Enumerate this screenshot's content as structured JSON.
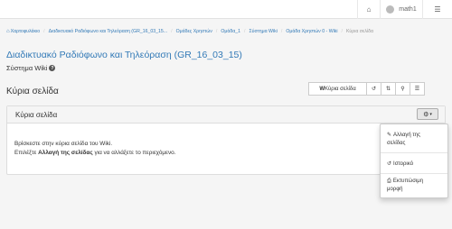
{
  "topbar": {
    "home_icon": "home-icon",
    "user_name": "math1",
    "menu_icon": "sliders-icon"
  },
  "breadcrumb": [
    "Χαρτοφυλάκιο",
    "Διαδικτυακό Ραδιόφωνο και Τηλεόραση (GR_16_03_15...",
    "Ομάδες Χρηστών",
    "Ομάδα_1",
    "Σύστημα Wiki",
    "Ομάδα Χρηστών 0 - Wiki",
    "Κύρια σελίδα"
  ],
  "course_title": "Διαδικτυακό Ραδιόφωνο και Τηλεόραση (GR_16_03_15)",
  "page_subtitle": "Σύστημα Wiki",
  "section_title": "Κύρια σελίδα",
  "toolbar": {
    "home_label": "Κύρια σελίδα",
    "btn_history_icon": "history-icon",
    "btn_recent_icon": "recent-changes-icon",
    "btn_search_icon": "search-icon",
    "btn_list_icon": "list-icon"
  },
  "panel": {
    "title": "Κύρια σελίδα",
    "line1": "Βρίσκεστε στην κύρια σελίδα του Wiki.",
    "line2_pre": "Επιλέξτε ",
    "line2_bold": "Αλλαγή της σελίδας",
    "line2_post": " για να αλλάξετε το περιεχόμενο."
  },
  "dropdown": {
    "edit_line1": "Αλλαγή της",
    "edit_line2": "σελίδας",
    "history": "Ιστορικό",
    "print_line1": "Εκτυπώσιμη",
    "print_line2": "μορφή"
  }
}
